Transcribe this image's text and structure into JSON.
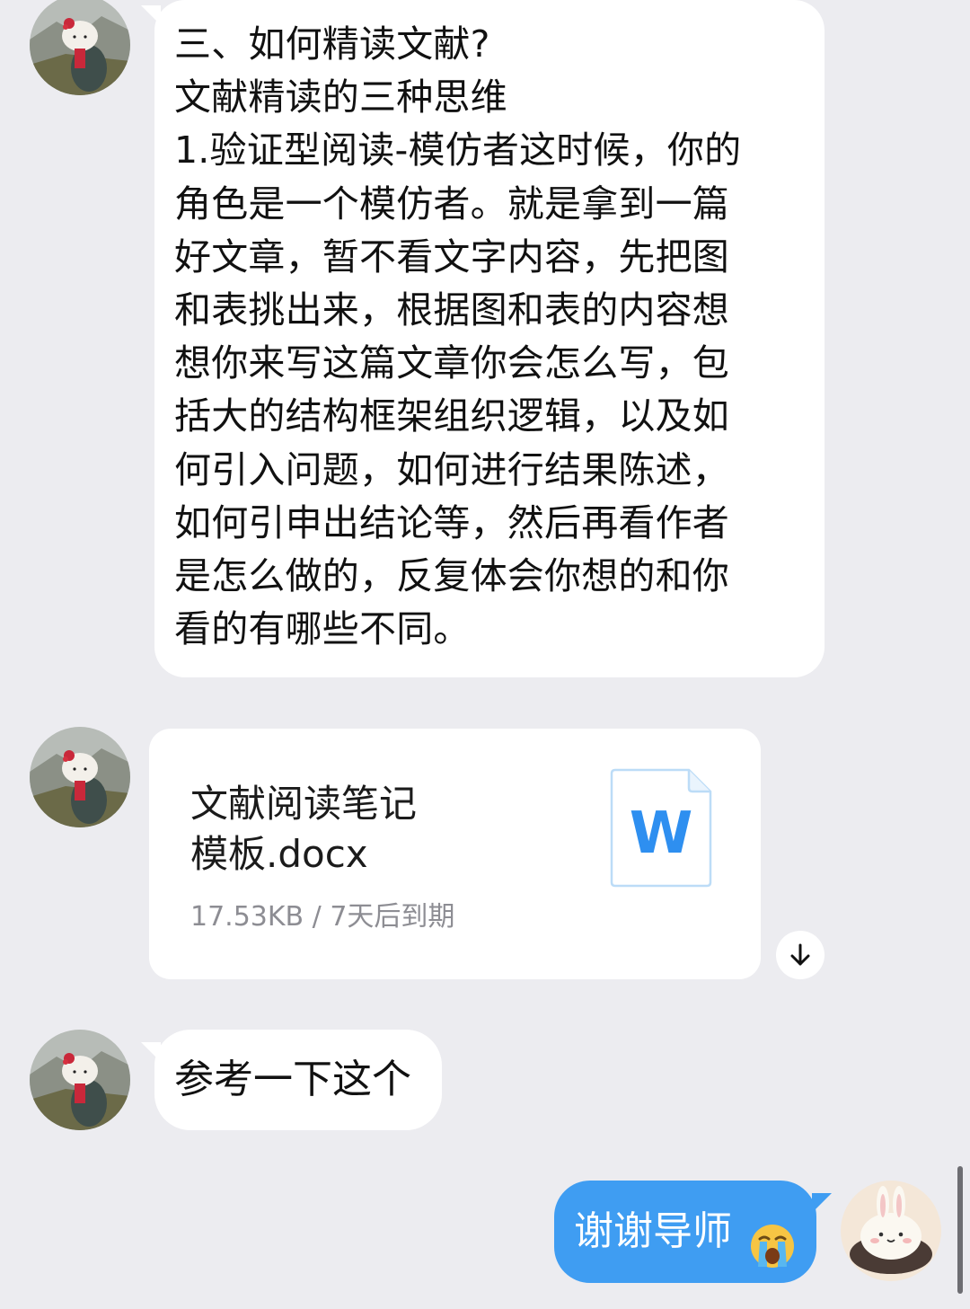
{
  "messages": {
    "first": {
      "lines": [
        "三、如何精读文献?",
        "文献精读的三种思维",
        "1.验证型阅读-模仿者这时候，你的",
        "角色是一个模仿者。就是拿到一篇",
        "好文章，暂不看文字内容，先把图",
        "和表挑出来，根据图和表的内容想",
        "想你来写这篇文章你会怎么写，包",
        "括大的结构框架组织逻辑，以及如",
        "何引入问题，如何进行结果陈述，",
        "如何引申出结论等，然后再看作者",
        "是怎么做的，反复体会你想的和你",
        "看的有哪些不同。"
      ]
    },
    "file": {
      "name_line1": "文献阅读笔记",
      "name_line2": "模板.docx",
      "meta": "17.53KB / 7天后到期",
      "icon_letter": "W"
    },
    "second": {
      "text": "参考一下这个"
    },
    "reply": {
      "text": "谢谢导师"
    }
  },
  "icons": {
    "file_icon": "word-document-icon",
    "download_icon": "download-arrow-icon",
    "emoji": "crying-face-emoji"
  },
  "colors": {
    "background": "#ececf0",
    "incoming_bubble": "#ffffff",
    "outgoing_bubble": "#3f9df2",
    "word_blue": "#2e8ff0",
    "meta_gray": "#8d8d93"
  }
}
